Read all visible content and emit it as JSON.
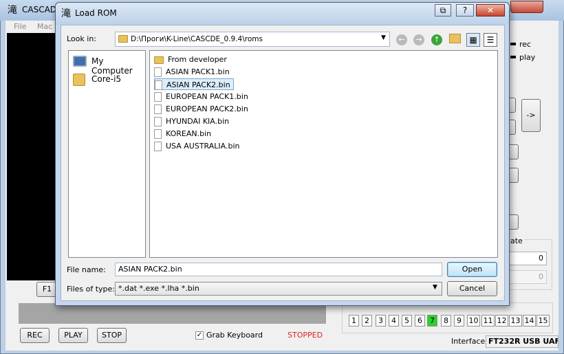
{
  "bg": {
    "title": "CASCAD",
    "menu": [
      "File",
      "Mac"
    ],
    "f1_label": "F1",
    "side": {
      "rec": "rec",
      "play": "play",
      "arrow_btn": "->",
      "rate_label": "ate",
      "val1": "0",
      "val2": "0"
    },
    "buttons": {
      "rec": "REC",
      "play": "PLAY",
      "stop": "STOP"
    },
    "grab_keyboard": "Grab Keyboard",
    "status": "STOPPED",
    "status_color": "#e02020",
    "leds": [
      "1",
      "2",
      "3",
      "4",
      "5",
      "6",
      "7",
      "8",
      "9",
      "10",
      "11",
      "12",
      "13",
      "14",
      "15"
    ],
    "active_led": "7",
    "interface_label": "Interface",
    "interface_value": "FT232R USB UAF"
  },
  "dialog": {
    "title": "Load ROM",
    "look_in_label": "Look in:",
    "look_in_path": "D:\\Проги\\K-Line\\CASCDE_0.9.4\\roms",
    "places": [
      {
        "label": "My Computer",
        "icon": "computer-icon"
      },
      {
        "label": "Core-i5",
        "icon": "user-folder-icon"
      }
    ],
    "files": [
      {
        "name": "From developer",
        "type": "folder"
      },
      {
        "name": "ASIAN PACK1.bin",
        "type": "file"
      },
      {
        "name": "ASIAN PACK2.bin",
        "type": "file",
        "selected": true
      },
      {
        "name": "EUROPEAN PACK1.bin",
        "type": "file"
      },
      {
        "name": "EUROPEAN PACK2.bin",
        "type": "file"
      },
      {
        "name": "HYUNDAI KIA.bin",
        "type": "file"
      },
      {
        "name": "KOREAN.bin",
        "type": "file"
      },
      {
        "name": "USA AUSTRALIA.bin",
        "type": "file"
      }
    ],
    "file_name_label": "File name:",
    "file_name_value": "ASIAN PACK2.bin",
    "files_of_type_label": "Files of type:",
    "files_of_type_value": "*.dat *.exe *.lha *.bin",
    "open_label": "Open",
    "cancel_label": "Cancel"
  }
}
